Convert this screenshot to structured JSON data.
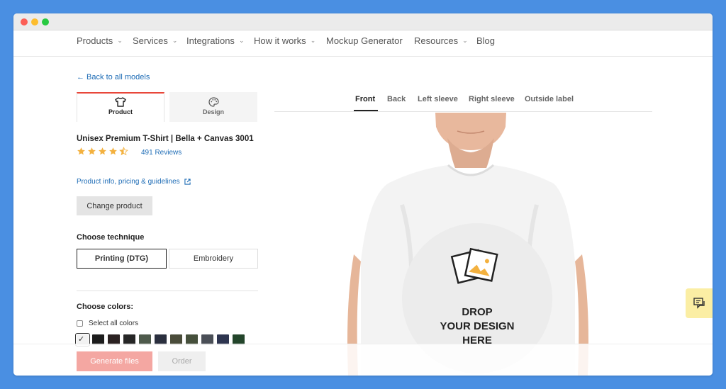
{
  "nav": {
    "items": [
      {
        "label": "Products",
        "dropdown": true
      },
      {
        "label": "Services",
        "dropdown": true
      },
      {
        "label": "Integrations",
        "dropdown": true
      },
      {
        "label": "How it works",
        "dropdown": true
      },
      {
        "label": "Mockup Generator",
        "dropdown": false
      },
      {
        "label": "Resources",
        "dropdown": true
      },
      {
        "label": "Blog",
        "dropdown": false
      }
    ]
  },
  "back_link": "← Back to all models",
  "side_tabs": {
    "product": "Product",
    "design": "Design"
  },
  "product": {
    "title": "Unisex Premium T-Shirt | Bella + Canvas 3001",
    "rating": 4.5,
    "rating_max": 5,
    "reviews": "491 Reviews",
    "info_link": "Product info, pricing & guidelines",
    "change_button": "Change product"
  },
  "technique": {
    "label": "Choose technique",
    "options": [
      "Printing (DTG)",
      "Embroidery"
    ],
    "selected": "Printing (DTG)"
  },
  "colors": {
    "label": "Choose colors:",
    "select_all": "Select all colors",
    "swatches": [
      "#f2f2f2",
      "#1d1d1d",
      "#2b2222",
      "#262626",
      "#4e5a4c",
      "#2a2f3e",
      "#4a4c3a",
      "#46503c",
      "#4a4f57",
      "#2e3550",
      "#23452b"
    ]
  },
  "views": {
    "tabs": [
      "Front",
      "Back",
      "Left sleeve",
      "Right sleeve",
      "Outside label"
    ],
    "active": "Front"
  },
  "drop_zone": {
    "line1": "DROP",
    "line2": "YOUR DESIGN",
    "line3": "HERE"
  },
  "actions": {
    "generate": "Generate files",
    "order": "Order"
  },
  "colors_theme": {
    "accent_red": "#e8473a",
    "link_blue": "#1c6bb5",
    "star": "#f3b13f",
    "chat_bg": "#fbeea4"
  }
}
